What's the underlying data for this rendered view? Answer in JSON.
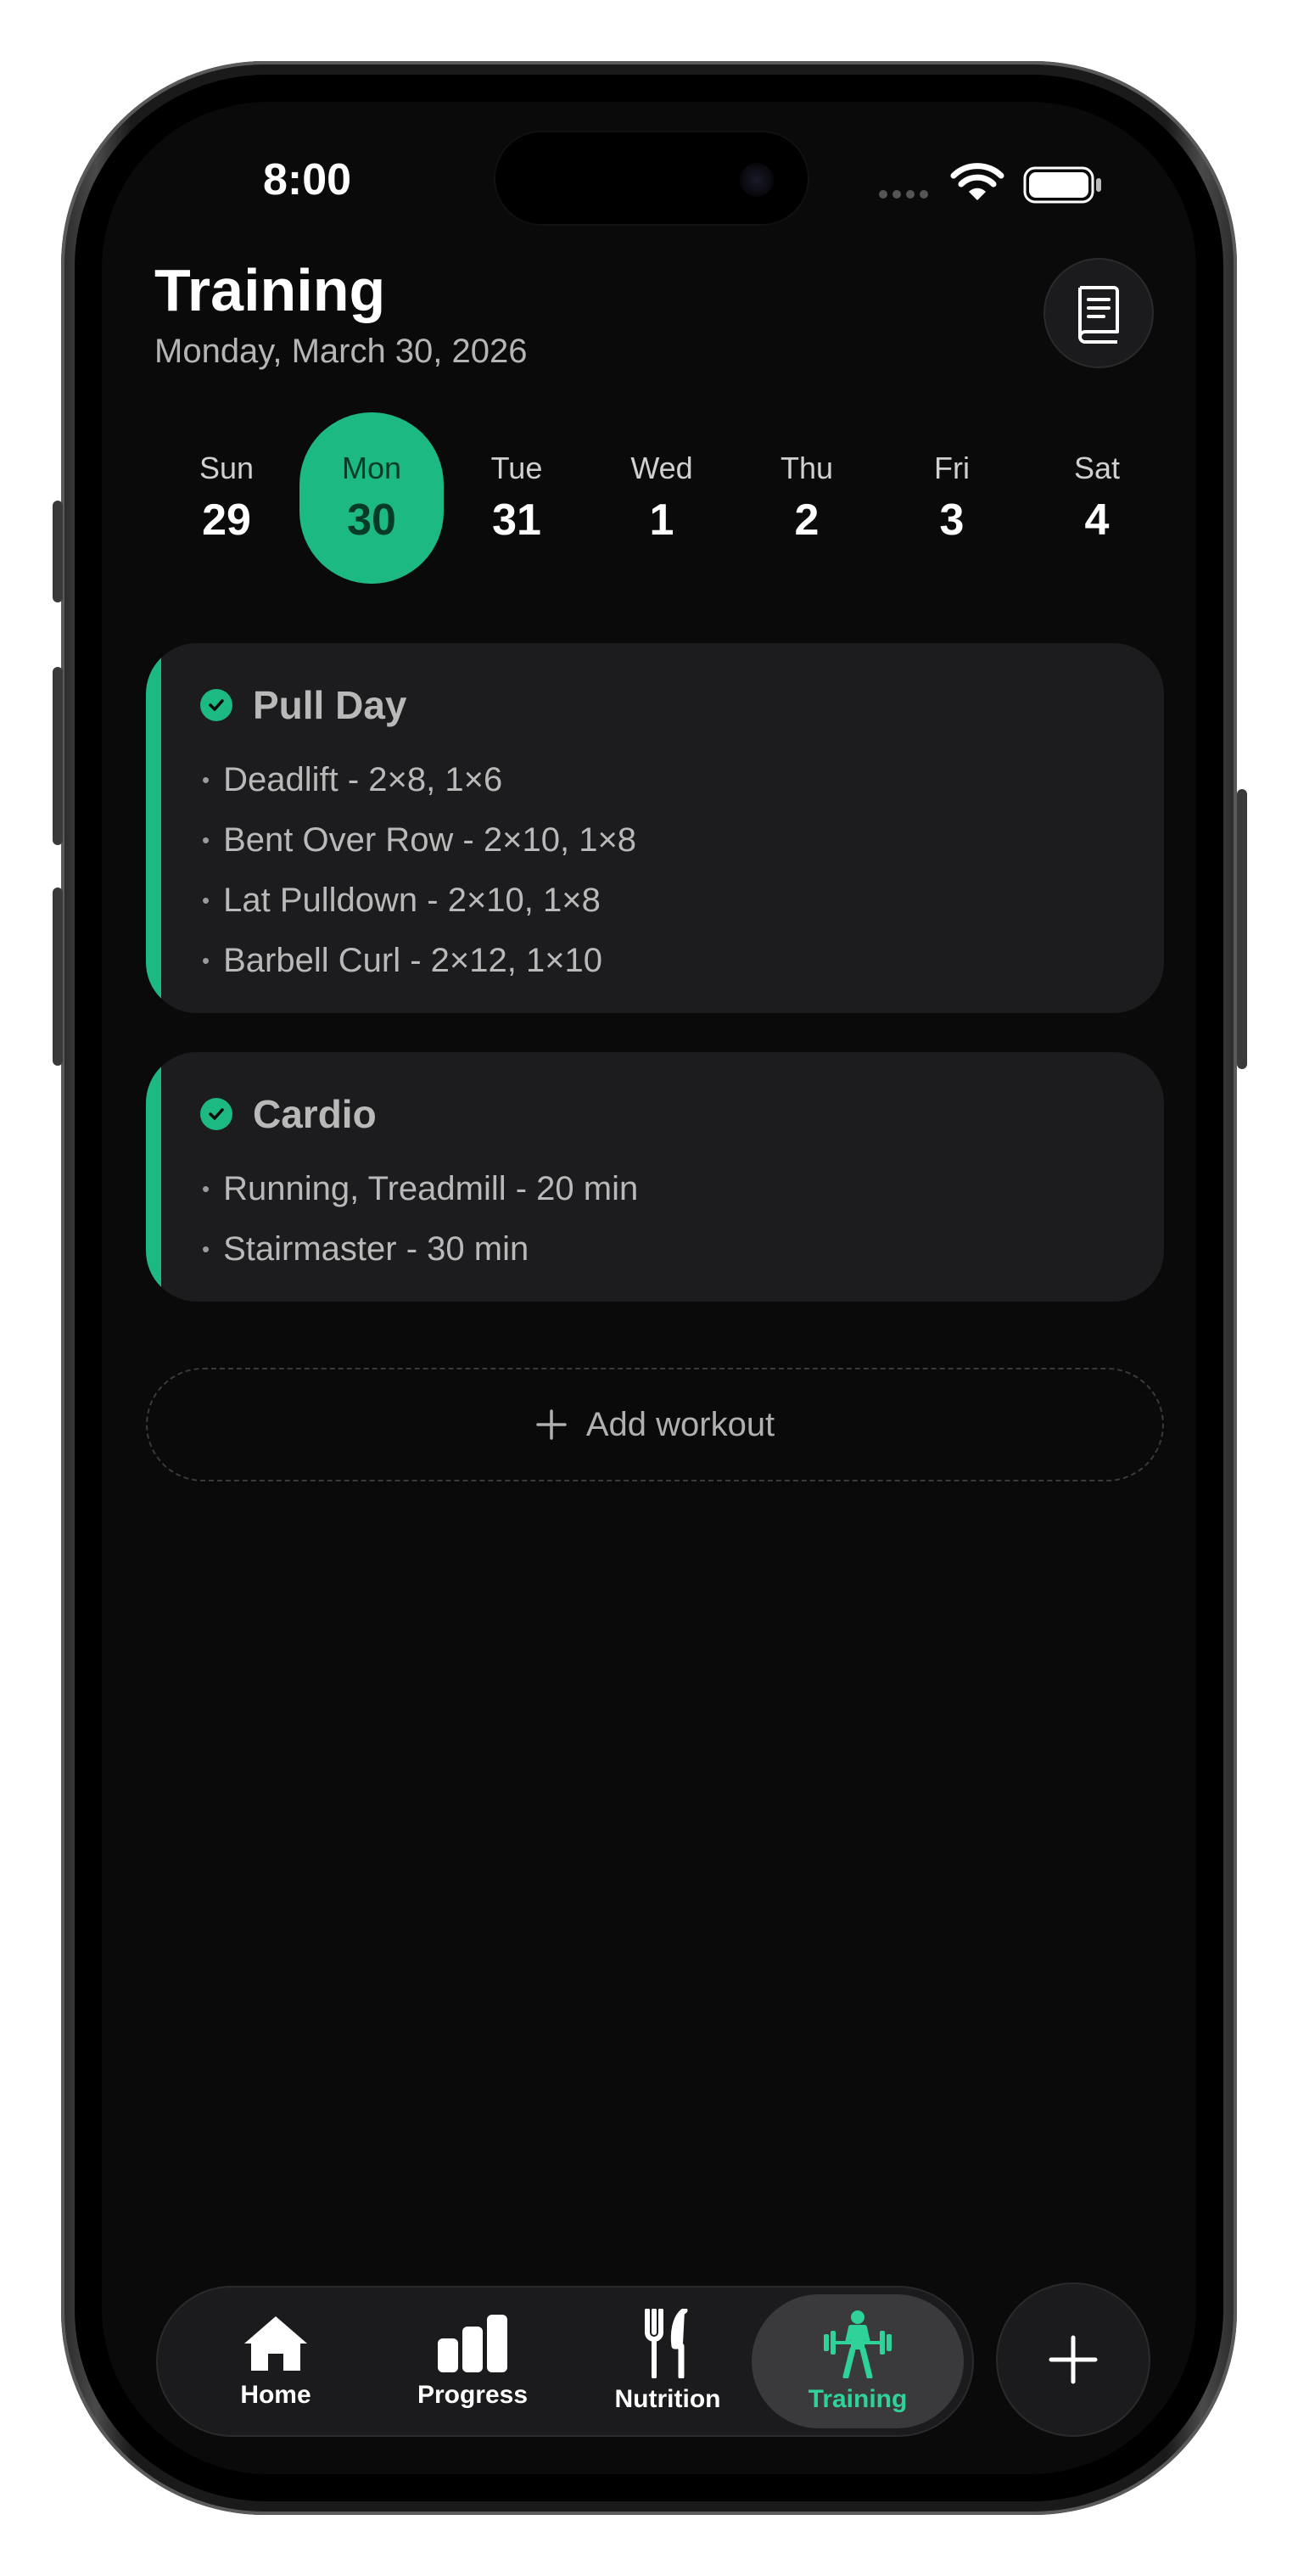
{
  "status_bar": {
    "time": "8:00"
  },
  "header": {
    "title": "Training",
    "date": "Monday, March 30, 2026"
  },
  "week": [
    {
      "day": "Sun",
      "num": "29"
    },
    {
      "day": "Mon",
      "num": "30",
      "selected": true
    },
    {
      "day": "Tue",
      "num": "31"
    },
    {
      "day": "Wed",
      "num": "1"
    },
    {
      "day": "Thu",
      "num": "2"
    },
    {
      "day": "Fri",
      "num": "3"
    },
    {
      "day": "Sat",
      "num": "4"
    }
  ],
  "workouts": [
    {
      "title": "Pull Day",
      "completed": true,
      "exercises": [
        "Deadlift - 2×8, 1×6",
        "Bent Over Row - 2×10, 1×8",
        "Lat Pulldown - 2×10, 1×8",
        "Barbell Curl - 2×12, 1×10"
      ]
    },
    {
      "title": "Cardio",
      "completed": true,
      "exercises": [
        "Running, Treadmill - 20 min",
        "Stairmaster - 30 min"
      ]
    }
  ],
  "add_workout_label": "Add workout",
  "tabs": [
    {
      "label": "Home",
      "icon": "home-icon"
    },
    {
      "label": "Progress",
      "icon": "bar-chart-icon"
    },
    {
      "label": "Nutrition",
      "icon": "fork-knife-icon"
    },
    {
      "label": "Training",
      "icon": "weightlifter-icon",
      "active": true
    }
  ],
  "colors": {
    "accent": "#1db982",
    "background": "#0a0a0a",
    "card": "#1c1c1e"
  }
}
